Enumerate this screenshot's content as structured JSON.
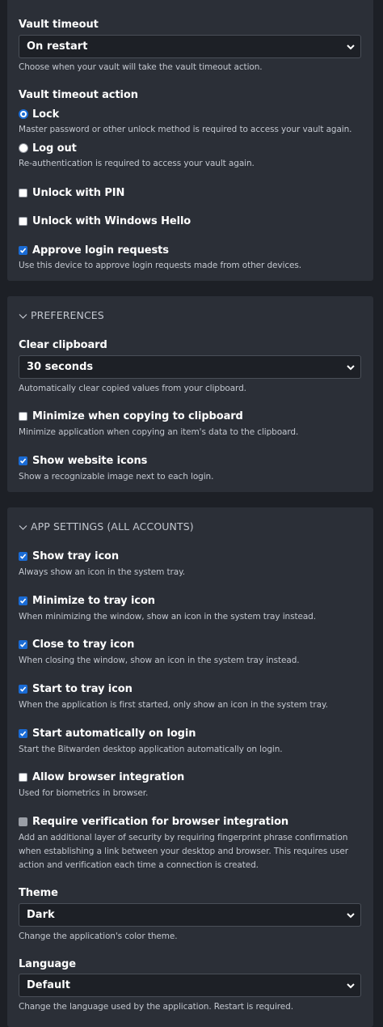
{
  "security": {
    "vault_timeout_label": "Vault timeout",
    "vault_timeout_value": "On restart",
    "vault_timeout_hint": "Choose when your vault will take the vault timeout action.",
    "timeout_action_label": "Vault timeout action",
    "lock_label": "Lock",
    "lock_hint": "Master password or other unlock method is required to access your vault again.",
    "logout_label": "Log out",
    "logout_hint": "Re-authentication is required to access your vault again.",
    "unlock_pin_label": "Unlock with PIN",
    "unlock_hello_label": "Unlock with Windows Hello",
    "approve_login_label": "Approve login requests",
    "approve_login_hint": "Use this device to approve login requests made from other devices.",
    "lock_selected": true,
    "unlock_pin_checked": false,
    "unlock_hello_checked": false,
    "approve_login_checked": true
  },
  "preferences": {
    "heading": "PREFERENCES",
    "clear_clipboard_label": "Clear clipboard",
    "clear_clipboard_value": "30 seconds",
    "clear_clipboard_hint": "Automatically clear copied values from your clipboard.",
    "minimize_copy_label": "Minimize when copying to clipboard",
    "minimize_copy_hint": "Minimize application when copying an item's data to the clipboard.",
    "minimize_copy_checked": false,
    "website_icons_label": "Show website icons",
    "website_icons_hint": "Show a recognizable image next to each login.",
    "website_icons_checked": true
  },
  "app_settings": {
    "heading": "APP SETTINGS (ALL ACCOUNTS)",
    "tray_icon_label": "Show tray icon",
    "tray_icon_hint": "Always show an icon in the system tray.",
    "minimize_tray_label": "Minimize to tray icon",
    "minimize_tray_hint": "When minimizing the window, show an icon in the system tray instead.",
    "close_tray_label": "Close to tray icon",
    "close_tray_hint": "When closing the window, show an icon in the system tray instead.",
    "start_tray_label": "Start to tray icon",
    "start_tray_hint": "When the application is first started, only show an icon in the system tray.",
    "auto_start_label": "Start automatically on login",
    "auto_start_hint": "Start the Bitwarden desktop application automatically on login.",
    "browser_integration_label": "Allow browser integration",
    "browser_integration_hint": "Used for biometrics in browser.",
    "require_verification_label": "Require verification for browser integration",
    "require_verification_hint": "Add an additional layer of security by requiring fingerprint phrase confirmation when establishing a link between your desktop and browser. This requires user action and verification each time a connection is created.",
    "theme_label": "Theme",
    "theme_value": "Dark",
    "theme_hint": "Change the application's color theme.",
    "language_label": "Language",
    "language_value": "Default",
    "language_hint": "Change the language used by the application. Restart is required."
  },
  "colors": {
    "accent": "#1a6bd4",
    "card_bg": "#2b2f37",
    "page_bg": "#1d2026"
  }
}
